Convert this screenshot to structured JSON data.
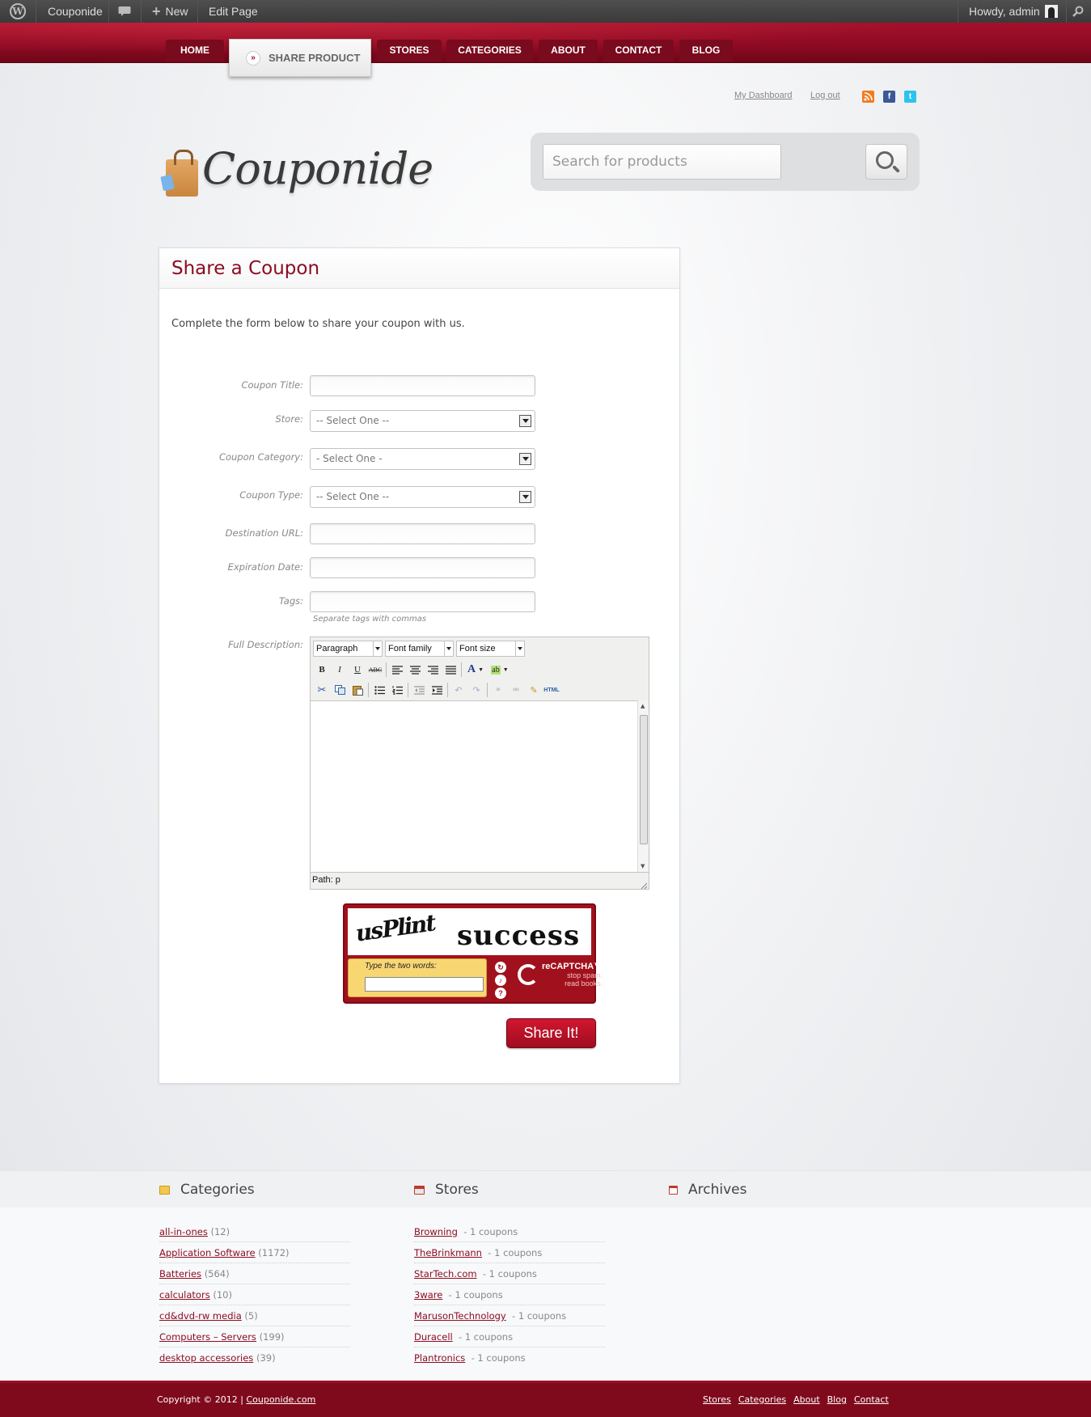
{
  "admin_bar": {
    "site_name": "Couponide",
    "new_label": "New",
    "edit_label": "Edit Page",
    "howdy": "Howdy, admin"
  },
  "nav": {
    "items": [
      "HOME",
      "STORES",
      "CATEGORIES",
      "ABOUT",
      "CONTACT",
      "BLOG"
    ],
    "active": "SHARE PRODUCT"
  },
  "top_links": {
    "dashboard": "My Dashboard",
    "logout": "Log out"
  },
  "social": [
    {
      "name": "rss-icon",
      "color": "#f47a20"
    },
    {
      "name": "facebook-icon",
      "color": "#3b5998"
    },
    {
      "name": "twitter-icon",
      "color": "#2fc2ef"
    }
  ],
  "logo": {
    "text": "Couponide"
  },
  "search": {
    "placeholder": "Search for products"
  },
  "form": {
    "title": "Share a Coupon",
    "intro": "Complete the form below to share your coupon with us.",
    "labels": {
      "coupon_title": "Coupon Title:",
      "store": "Store:",
      "category": "Coupon Category:",
      "type": "Coupon Type:",
      "url": "Destination URL:",
      "expiration": "Expiration Date:",
      "tags": "Tags:",
      "description": "Full Description:"
    },
    "selects": {
      "store": "-- Select One --",
      "category": "- Select One -",
      "type": "-- Select One --"
    },
    "tags_hint": "Separate tags with commas",
    "editor": {
      "format": "Paragraph",
      "font_family": "Font family",
      "font_size": "Font size",
      "path": "Path: p"
    },
    "captcha": {
      "word1": "usPlint",
      "word2": "success",
      "prompt": "Type the two words:",
      "brand": "reCAPTCHA™",
      "tagline1": "stop spam.",
      "tagline2": "read books."
    },
    "submit": "Share It!"
  },
  "widgets": {
    "categories": {
      "title": "Categories",
      "items": [
        {
          "name": "all-in-ones",
          "count": "(12)"
        },
        {
          "name": "Application Software",
          "count": "(1172)"
        },
        {
          "name": "Batteries",
          "count": "(564)"
        },
        {
          "name": "calculators",
          "count": "(10)"
        },
        {
          "name": "cd&dvd-rw media",
          "count": "(5)"
        },
        {
          "name": "Computers – Servers",
          "count": "(199)"
        },
        {
          "name": "desktop accessories",
          "count": "(39)"
        }
      ]
    },
    "stores": {
      "title": "Stores",
      "items": [
        {
          "name": "Browning",
          "count": "- 1 coupons"
        },
        {
          "name": "TheBrinkmann",
          "count": "- 1 coupons"
        },
        {
          "name": "StarTech.com",
          "count": "- 1 coupons"
        },
        {
          "name": "3ware",
          "count": "- 1 coupons"
        },
        {
          "name": "MarusonTechnology",
          "count": "- 1 coupons"
        },
        {
          "name": "Duracell",
          "count": "- 1 coupons"
        },
        {
          "name": "Plantronics",
          "count": "- 1 coupons"
        }
      ]
    },
    "archives": {
      "title": "Archives"
    }
  },
  "footer": {
    "copyright": "Copyright © 2012 |",
    "site_link": "Couponide.com",
    "links": [
      "Stores",
      "Categories",
      "About",
      "Blog",
      "Contact"
    ]
  }
}
